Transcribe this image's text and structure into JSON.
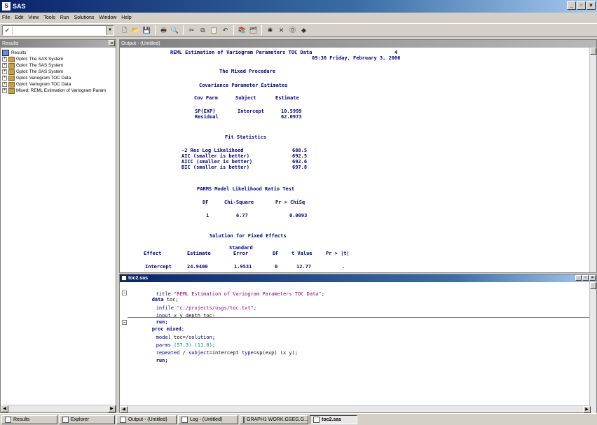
{
  "window": {
    "title": "SAS",
    "controls": [
      "_",
      "▫",
      "×"
    ]
  },
  "menu": [
    "File",
    "Edit",
    "View",
    "Tools",
    "Run",
    "Solutions",
    "Window",
    "Help"
  ],
  "command_box": {
    "check": "✓",
    "value": ""
  },
  "results": {
    "title": "Results",
    "root": "Results",
    "items": [
      "Gplot:  The SAS System",
      "Gplot:  The SAS System",
      "Gplot:  The SAS System",
      "Gplot:  Variogram TOC Data",
      "Gplot:  Variogram TOC Data",
      "Mixed:  REML Estimation of Variogram Param"
    ]
  },
  "output": {
    "title": "Output - (Untitled)",
    "header_title": "REML Estimation of Variogram Parameters TOC Data",
    "page_no": "4",
    "timestamp": "09:36 Friday, February 3, 2006",
    "procedure": "The Mixed Procedure",
    "cov_title": "Covariance Parameter Estimates",
    "cov_headers": [
      "Cov Parm",
      "Subject",
      "Estimate"
    ],
    "cov_rows": [
      [
        "SP(EXP)",
        "Intercept",
        "10.5999"
      ],
      [
        "Residual",
        "",
        "62.0973"
      ]
    ],
    "fit_title": "Fit Statistics",
    "fit_rows": [
      [
        "-2 Res Log Likelihood",
        "688.5"
      ],
      [
        "AIC (smaller is better)",
        "692.5"
      ],
      [
        "AICC (smaller is better)",
        "692.6"
      ],
      [
        "BIC (smaller is better)",
        "697.8"
      ]
    ],
    "lrt_title": "PARMS Model Likelihood Ratio Test",
    "lrt_headers": [
      "DF",
      "Chi-Square",
      "Pr > ChiSq"
    ],
    "lrt_row": [
      "1",
      "6.77",
      "0.0093"
    ],
    "fixed_title": "Solution for Fixed Effects",
    "fixed_std": "Standard",
    "fixed_headers": [
      "Effect",
      "Estimate",
      "Error",
      "DF",
      "t Value",
      "Pr > |t|"
    ],
    "fixed_row": [
      "Intercept",
      "24.9400",
      "1.9531",
      "0",
      "12.77",
      "."
    ]
  },
  "editor": {
    "title": "toc2.sas",
    "lines": {
      "l1_a": "title ",
      "l1_b": "\"REML Estimation of Variogram Parameters TOC Data\"",
      "l1_c": ";",
      "l2_a": "data",
      "l2_b": " toc;",
      "l3_a": "infile ",
      "l3_b": "\"c:/projects/usgs/toc.txt\"",
      "l3_c": ";",
      "l4_a": "input",
      "l4_b": " x y depth toc;",
      "l5": "run;",
      "l6_a": "proc mixed",
      "l6_b": ";",
      "l7_a": "model",
      "l7_b": " toc=/",
      "l7_c": "solution",
      "l7_d": ";",
      "l8_a": "parms",
      "l8_b": " (57.3) (11.0);",
      "l9_a": "repeated",
      "l9_b": " / ",
      "l9_c": "subject",
      "l9_d": "=intercept ",
      "l9_e": "type",
      "l9_f": "=sp(exp) (x y);",
      "l10": "run;"
    }
  },
  "taskbar": {
    "results_tab": "Results",
    "explorer_tab": "Explorer",
    "tabs": [
      "Output - (Untitled)",
      "Log - (Untitled)",
      "GRAPH1 WORK.GSEG.G...",
      "toc2.sas"
    ]
  }
}
